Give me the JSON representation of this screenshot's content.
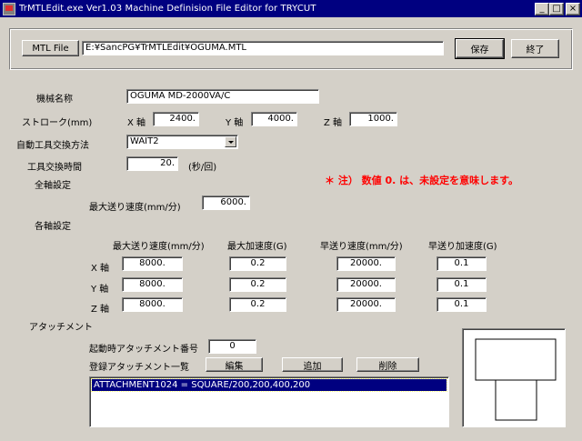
{
  "window": {
    "title": "TrMTLEdit.exe  Ver1.03    Machine Definision File Editor for TRYCUT"
  },
  "toolbar": {
    "mtl_file_label": "MTL File",
    "file_path": "E:¥SancPG¥TrMTLEdit¥OGUMA.MTL",
    "save_label": "保存",
    "exit_label": "終了"
  },
  "machine": {
    "name_label": "機械名称",
    "name_value": "OGUMA MD-2000VA/C",
    "stroke_label": "ストローク(mm)",
    "x_label": "X 軸",
    "x_value": "2400.",
    "y_label": "Y 軸",
    "y_value": "4000.",
    "z_label": "Z 軸",
    "z_value": "1000.",
    "atc_method_label": "自動工具交換方法",
    "atc_method_value": "WAIT2",
    "tool_change_time_label": "工具交換時間",
    "tool_change_time_value": "20.",
    "tool_change_time_unit": "(秒/回)",
    "note": "＊ 注） 数値 0. は、未設定を意味します。"
  },
  "all_axes": {
    "section_label": "全軸設定",
    "max_feed_label": "最大送り速度(mm/分)",
    "max_feed_value": "6000."
  },
  "each_axis": {
    "section_label": "各軸設定",
    "headers": [
      "最大送り速度(mm/分)",
      "最大加速度(G)",
      "早送り速度(mm/分)",
      "早送り加速度(G)"
    ],
    "rows": [
      {
        "axis": "X 軸",
        "values": [
          "8000.",
          "0.2",
          "20000.",
          "0.1"
        ]
      },
      {
        "axis": "Y 軸",
        "values": [
          "8000.",
          "0.2",
          "20000.",
          "0.1"
        ]
      },
      {
        "axis": "Z 軸",
        "values": [
          "8000.",
          "0.2",
          "20000.",
          "0.1"
        ]
      }
    ]
  },
  "attachment": {
    "section_label": "アタッチメント",
    "startup_label": "起動時アタッチメント番号",
    "startup_value": "0",
    "list_label": "登録アタッチメント一覧",
    "edit_label": "編集",
    "add_label": "追加",
    "delete_label": "削除",
    "items": [
      "ATTACHMENT1024 = SQUARE/200,200,400,200"
    ]
  }
}
